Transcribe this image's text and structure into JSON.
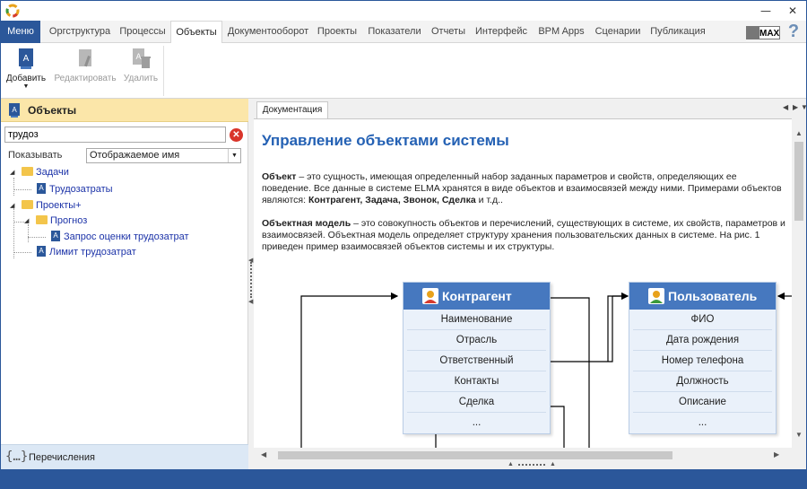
{
  "menubar": {
    "menu_label": "Меню",
    "tabs": [
      "Оргструктура",
      "Процессы",
      "Объекты",
      "Документооборот",
      "Проекты",
      "Показатели",
      "Отчеты",
      "Интерфейс",
      "BPM Apps",
      "Сценарии",
      "Публикация"
    ],
    "active_tab": "Объекты",
    "max_badge": "MAX",
    "help": "?"
  },
  "window": {
    "minimize": "—",
    "close": "✕"
  },
  "ribbon": {
    "add_label": "Добавить",
    "edit_label": "Редактировать",
    "delete_label": "Удалить"
  },
  "left_panel": {
    "title": "Объекты",
    "search_value": "трудоз",
    "show_label": "Показывать",
    "show_value": "Отображаемое имя",
    "tree": [
      {
        "label": "Задачи",
        "type": "folder"
      },
      {
        "label": "Трудозатраты",
        "type": "object"
      },
      {
        "label": "Проекты+",
        "type": "folder"
      },
      {
        "label": "Прогноз",
        "type": "folder"
      },
      {
        "label": "Запрос оценки трудозатрат",
        "type": "object"
      },
      {
        "label": "Лимит трудозатрат",
        "type": "object"
      }
    ],
    "enumerations_label": "Перечисления"
  },
  "right_panel": {
    "tab_label": "Документация",
    "heading": "Управление объектами системы",
    "p1_term": "Объект",
    "p1_text": " – это сущность, имеющая определенный набор заданных параметров и свойств, определяющих ее поведение. Все данные в системе ELMA хранятся в виде объектов и взаимосвязей между ними. Примерами объектов являются: ",
    "p1_examples": "Контрагент, Задача, Звонок, Сделка",
    "p1_tail": " и т.д..",
    "p2_term": "Объектная модель",
    "p2_text": " – это совокупность объектов и перечислений, существующих в системе, их свойств, параметров и взаимосвязей. Объектная модель определяет структуру хранения пользовательских данных в системе. На рис. 1 приведен пример взаимосвязей объектов системы и их структуры."
  },
  "diagram": {
    "card1": {
      "title": "Контрагент",
      "fields": [
        "Наименование",
        "Отрасль",
        "Ответственный",
        "Контакты",
        "Сделка",
        "..."
      ]
    },
    "card2": {
      "title": "Пользователь",
      "fields": [
        "ФИО",
        "Дата рождения",
        "Номер телефона",
        "Должность",
        "Описание",
        "..."
      ]
    }
  }
}
